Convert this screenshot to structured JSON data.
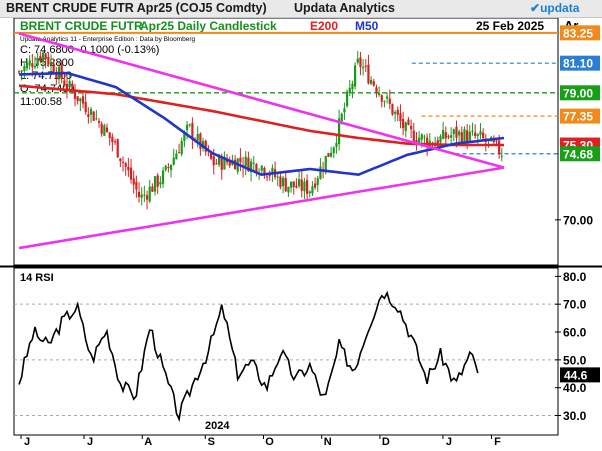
{
  "title_bar": {
    "main": "BRENT CRUDE FUTR  Apr25 (COJ5 Comdty)",
    "brand": "Updata Analytics",
    "logo": "updata"
  },
  "header": {
    "name": "BRENT CRUDE FUTR",
    "contract": "Apr25 Daily Candlestick",
    "e200": "E200",
    "m50": "M50",
    "date": "25 Feb 2025",
    "corner": "Ar"
  },
  "info": {
    "source": "Updata Analytics 11 - Enterprise Edition : Data by Bloomberg",
    "close": "C: 74.6800  -0.1000 (-0.13%)",
    "high": "H: 75.2800",
    "low": "L: 74.7100",
    "open": "O: 74.7400",
    "extra": "11:00.58"
  },
  "colors": {
    "candle_up": "#1a9a1a",
    "candle_down": "#d42020",
    "e200": "#e02020",
    "m50": "#1f36c8",
    "triangle": "#ee33ee",
    "level_orange": "#f08a1a",
    "level_green": "#16a016",
    "level_blue": "#2a7fd4",
    "rsi_line": "#000000"
  },
  "price_labels": [
    {
      "text": "83.25",
      "bg": "#f08a1a",
      "fg": "#ffffff"
    },
    {
      "text": "81.10",
      "bg": "#2a7fd4",
      "fg": "#ffffff"
    },
    {
      "text": "79.00",
      "bg": "#16a016",
      "fg": "#ffffff"
    },
    {
      "text": "77.35",
      "bg": "#f08a1a",
      "fg": "#ffffff"
    },
    {
      "text": "75.30",
      "bg": "#e02020",
      "fg": "#ffffff"
    },
    {
      "text": "74.68",
      "bg": "#16a016",
      "fg": "#ffffff"
    },
    {
      "text": "70.00",
      "bg": "",
      "fg": "#000000"
    }
  ],
  "rsi": {
    "label": "14 RSI",
    "ticks": [
      "80.0",
      "70.0",
      "60.0",
      "50.0",
      "40.0",
      "30.0"
    ],
    "current": "44.6"
  },
  "x_axis": {
    "months": [
      "J",
      "J",
      "A",
      "S",
      "O",
      "N",
      "D",
      "J",
      "F"
    ],
    "year": "2024"
  },
  "chart_data": {
    "type": "line",
    "title": "BRENT CRUDE FUTR Apr25 Daily Candlestick",
    "xlabel": "",
    "ylabel": "",
    "x_period": [
      "2024-06",
      "2025-02"
    ],
    "ylim_price": [
      66.8,
      84.3
    ],
    "ylim_rsi": [
      23,
      83
    ],
    "levels": [
      83.25,
      81.1,
      79.0,
      77.35,
      74.68
    ],
    "last_close": 74.68,
    "triangle": {
      "upper_from": [
        0,
        83.2
      ],
      "upper_to": [
        100,
        73.7
      ],
      "lower_from": [
        0,
        68.0
      ],
      "lower_to": [
        100,
        73.7
      ]
    },
    "series": [
      {
        "name": "Price",
        "x": [
          0,
          5,
          10,
          15,
          20,
          25,
          30,
          35,
          40,
          45,
          50,
          55,
          60,
          65,
          70,
          75,
          80,
          85,
          90,
          95,
          100
        ],
        "values": [
          80.5,
          81.8,
          79.5,
          77.6,
          75.2,
          71.5,
          73.2,
          76.5,
          74.0,
          74.2,
          73.8,
          72.5,
          72.2,
          75.5,
          81.2,
          78.8,
          76.2,
          75.5,
          76.1,
          75.8,
          74.7
        ]
      },
      {
        "name": "E200",
        "x": [
          0,
          10,
          20,
          30,
          40,
          50,
          60,
          70,
          80,
          90,
          100
        ],
        "values": [
          79.5,
          79.2,
          78.9,
          78.3,
          77.7,
          77.0,
          76.3,
          75.8,
          75.4,
          75.3,
          75.3
        ]
      },
      {
        "name": "M50",
        "x": [
          0,
          10,
          20,
          30,
          40,
          50,
          60,
          70,
          80,
          90,
          100
        ],
        "values": [
          80.3,
          80.4,
          79.4,
          77.2,
          74.7,
          73.2,
          73.6,
          73.2,
          74.6,
          75.4,
          75.8
        ]
      },
      {
        "name": "14 RSI",
        "x": [
          0,
          3,
          6,
          9,
          12,
          15,
          18,
          21,
          24,
          27,
          30,
          33,
          36,
          39,
          42,
          45,
          48,
          51,
          54,
          57,
          60,
          63,
          66,
          69,
          72,
          75,
          78,
          81,
          84,
          87,
          90,
          93,
          95
        ],
        "values": [
          42,
          60,
          55,
          64,
          69,
          50,
          61,
          41,
          37,
          62,
          45,
          30,
          42,
          53,
          69,
          45,
          49,
          40,
          53,
          43,
          48,
          35,
          55,
          46,
          62,
          75,
          70,
          58,
          43,
          52,
          41,
          52,
          44.6
        ]
      }
    ]
  }
}
